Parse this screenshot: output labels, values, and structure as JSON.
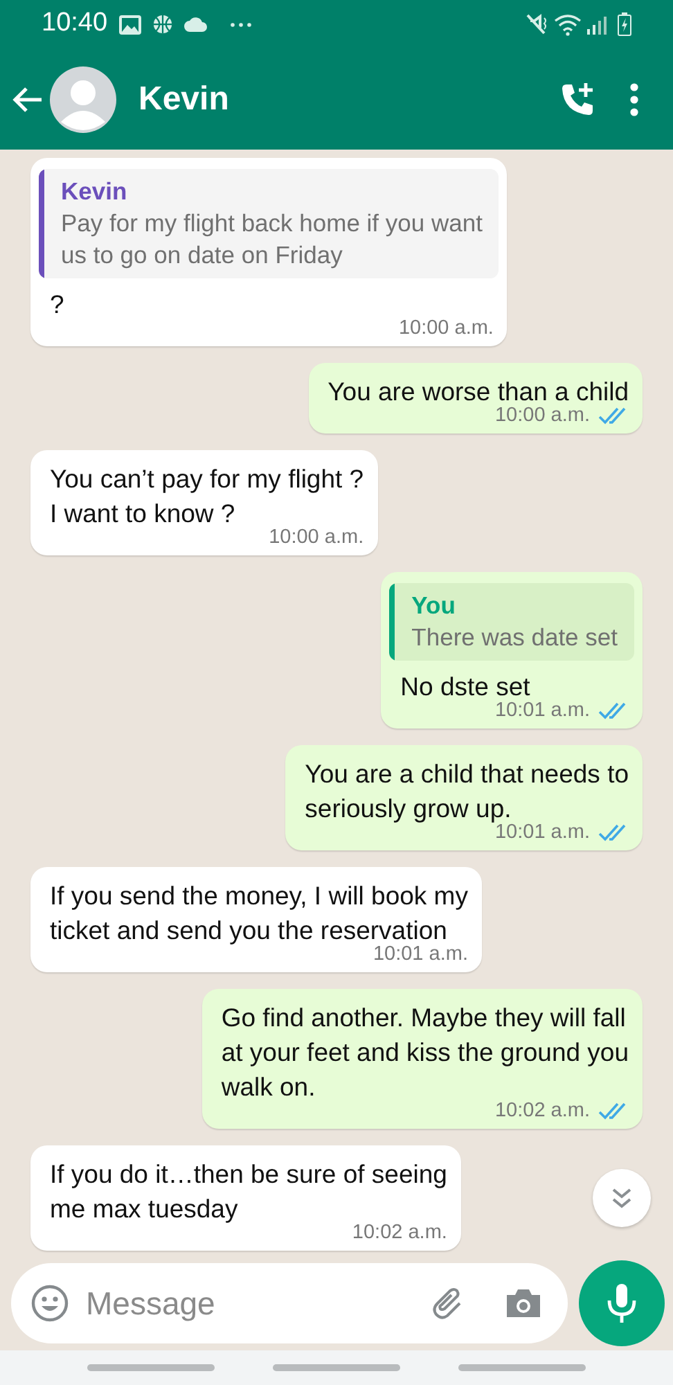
{
  "status_bar": {
    "time": "10:40"
  },
  "header": {
    "contact": "Kevin"
  },
  "messages": [
    {
      "kind": "incoming",
      "quote": {
        "author": "Kevin",
        "text": "Pay for my flight back home if you want\nus to go on date on Friday",
        "color": "#6b4fbb"
      },
      "text": "?",
      "time": "10:00 a.m."
    },
    {
      "kind": "outgoing",
      "text": "You are worse than a child",
      "time": "10:00 a.m.",
      "read": true
    },
    {
      "kind": "incoming",
      "text": "You can’t pay for my flight ?\nI want to know ?",
      "time": "10:00 a.m."
    },
    {
      "kind": "outgoing",
      "quote": {
        "author": "You",
        "text": "There was date set",
        "color": "#06a77d"
      },
      "text": "No dste set",
      "time": "10:01 a.m.",
      "read": true
    },
    {
      "kind": "outgoing",
      "text": "You are a child that needs to\nseriously grow up.",
      "time": "10:01 a.m.",
      "read": true
    },
    {
      "kind": "incoming",
      "text": "If you send the money, I will book my\nticket and send you the reservation",
      "time": "10:01 a.m."
    },
    {
      "kind": "outgoing",
      "text": "Go find another.  Maybe they will fall\nat your feet and kiss the ground you\nwalk on.",
      "time": "10:02 a.m.",
      "read": true
    },
    {
      "kind": "incoming",
      "text": "If you do it…then be sure of seeing\nme max tuesday",
      "time": "10:02 a.m."
    }
  ],
  "composer": {
    "placeholder": "Message"
  }
}
